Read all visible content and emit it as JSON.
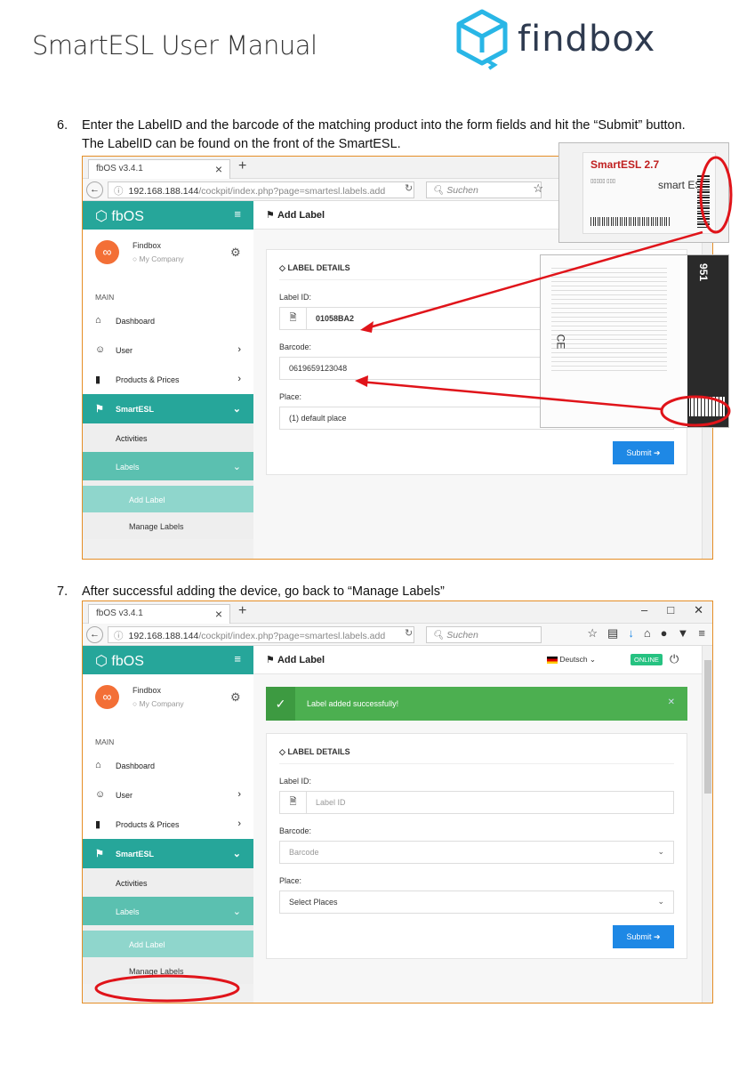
{
  "header": {
    "title": "SmartESL User Manual",
    "logo_text": "findbox"
  },
  "step6": {
    "num": "6.",
    "text": "Enter the LabelID and the barcode of the matching product into the form fields and hit the “Submit” button. The LabelID can be found on the front of the SmartESL."
  },
  "step7": {
    "num": "7.",
    "text": "After successful adding the device, go back to “Manage Labels”"
  },
  "browser": {
    "tab_title": "fbOS v3.4.1",
    "url_host": "192.168.188.144",
    "url_path": "/cockpit/index.php?page=smartesl.labels.add",
    "search_placeholder": "Suchen"
  },
  "app": {
    "brand": "fbOS",
    "profile_name": "Findbox",
    "profile_company": "My Company",
    "nav_heading": "MAIN",
    "nav": {
      "dashboard": "Dashboard",
      "user": "User",
      "products": "Products & Prices",
      "smartesl": "SmartESL",
      "activities": "Activities",
      "labels": "Labels",
      "add_label": "Add Label",
      "manage_labels": "Manage Labels"
    },
    "page_title": "Add Label",
    "language": "Deutsch",
    "status": "ONLINE",
    "card_title": "LABEL DETAILS",
    "label_id_label": "Label ID:",
    "barcode_label": "Barcode:",
    "place_label": "Place:",
    "submit": "Submit"
  },
  "form1": {
    "label_id": "01058BA2",
    "barcode": "0619659123048",
    "place": "(1) default place"
  },
  "form2": {
    "alert": "Label added successfully!",
    "label_id_placeholder": "Label ID",
    "barcode_placeholder": "Barcode",
    "place_placeholder": "Select Places"
  },
  "photo_esl": {
    "brand": "SmartESL 2.7",
    "sub": "smart ESL"
  },
  "photo_box": {
    "code": "951"
  },
  "colors": {
    "teal": "#26a69a",
    "annotation": "#e0141a",
    "submit": "#1e88e5",
    "success": "#4caf50"
  }
}
